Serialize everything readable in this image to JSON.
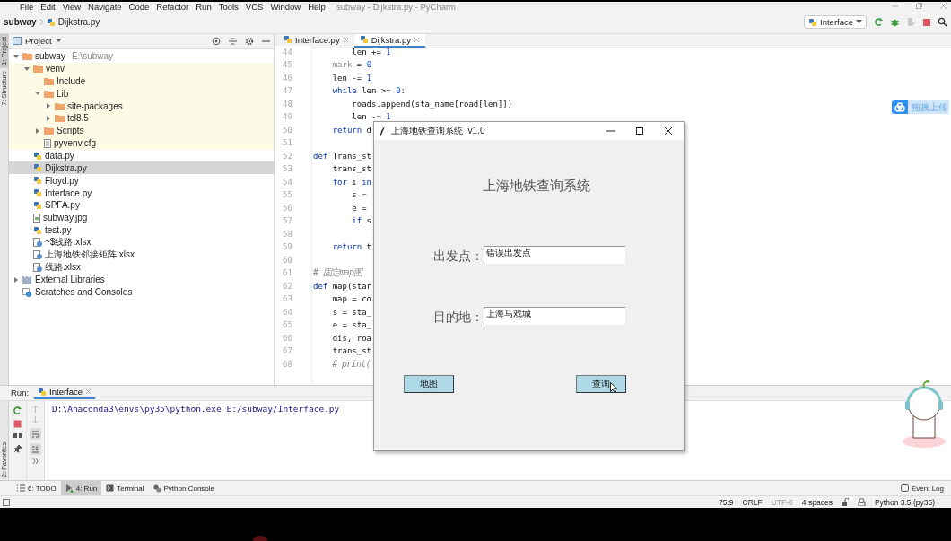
{
  "window": {
    "title": "subway - Dijkstra.py - PyCharm"
  },
  "menu": [
    "File",
    "Edit",
    "View",
    "Navigate",
    "Code",
    "Refactor",
    "Run",
    "Tools",
    "VCS",
    "Window",
    "Help"
  ],
  "breadcrumb": [
    {
      "label": "subway",
      "kind": "project"
    },
    {
      "label": "Dijkstra.py",
      "kind": "python"
    }
  ],
  "run_config": {
    "label": "Interface"
  },
  "side_tabs": [
    {
      "label": "1: Project",
      "selected": true
    },
    {
      "label": "7: Structure",
      "selected": false
    }
  ],
  "favorites_tab": {
    "label": "2: Favorites"
  },
  "project_panel": {
    "title": "Project",
    "tree": [
      {
        "label": "subway",
        "path": "E:\\subway",
        "kind": "folder",
        "expanded": true,
        "selected": false,
        "excluded": false,
        "children": [
          {
            "label": "venv",
            "kind": "folder",
            "expanded": true,
            "selected": false,
            "excluded": true,
            "children": [
              {
                "label": "Include",
                "kind": "folder",
                "selected": false,
                "excluded": true
              },
              {
                "label": "Lib",
                "kind": "folder",
                "expanded": true,
                "selected": false,
                "excluded": true,
                "children": [
                  {
                    "label": "site-packages",
                    "kind": "folder",
                    "expanded": false,
                    "selected": false,
                    "excluded": true
                  },
                  {
                    "label": "tcl8.5",
                    "kind": "folder",
                    "expanded": false,
                    "selected": false,
                    "excluded": true
                  }
                ]
              },
              {
                "label": "Scripts",
                "kind": "folder",
                "expanded": false,
                "selected": false,
                "excluded": true
              },
              {
                "label": "pyvenv.cfg",
                "kind": "text",
                "selected": false,
                "excluded": true
              }
            ]
          },
          {
            "label": "data.py",
            "kind": "python",
            "selected": false,
            "excluded": false
          },
          {
            "label": "Dijkstra.py",
            "kind": "python",
            "selected": true,
            "excluded": false
          },
          {
            "label": "Floyd.py",
            "kind": "python",
            "selected": false,
            "excluded": false
          },
          {
            "label": "Interface.py",
            "kind": "python",
            "selected": false,
            "excluded": false
          },
          {
            "label": "SPFA.py",
            "kind": "python",
            "selected": false,
            "excluded": false
          },
          {
            "label": "subway.jpg",
            "kind": "image",
            "selected": false,
            "excluded": false
          },
          {
            "label": "test.py",
            "kind": "python",
            "selected": false,
            "excluded": false
          },
          {
            "label": "~$线路.xlsx",
            "kind": "unknown",
            "selected": false,
            "excluded": false
          },
          {
            "label": "上海地铁邻接矩阵.xlsx",
            "kind": "unknown",
            "selected": false,
            "excluded": false
          },
          {
            "label": "线路.xlsx",
            "kind": "unknown",
            "selected": false,
            "excluded": false
          }
        ]
      },
      {
        "label": "External Libraries",
        "kind": "library",
        "expanded": false,
        "selected": false,
        "excluded": false
      },
      {
        "label": "Scratches and Consoles",
        "kind": "scratch",
        "selected": false,
        "excluded": false
      }
    ]
  },
  "editor": {
    "tabs": [
      {
        "label": "Interface.py",
        "selected": false
      },
      {
        "label": "Dijkstra.py",
        "selected": true
      }
    ],
    "lines": [
      {
        "number": "44",
        "segments": [
          {
            "text": "        len += ",
            "kind": "plain"
          },
          {
            "text": "1",
            "kind": "number"
          }
        ]
      },
      {
        "number": "45",
        "segments": [
          {
            "text": "    mark",
            "kind": "unused"
          },
          {
            "text": " = ",
            "kind": "plain"
          },
          {
            "text": "0",
            "kind": "number"
          }
        ]
      },
      {
        "number": "46",
        "segments": [
          {
            "text": "    len -= ",
            "kind": "plain"
          },
          {
            "text": "1",
            "kind": "number"
          }
        ]
      },
      {
        "number": "47",
        "segments": [
          {
            "text": "    while",
            "kind": "keyword"
          },
          {
            "text": " len >= ",
            "kind": "plain"
          },
          {
            "text": "0",
            "kind": "number"
          },
          {
            "text": ":",
            "kind": "plain"
          }
        ]
      },
      {
        "number": "48",
        "segments": [
          {
            "text": "        roads.append(sta_name[road[len]])",
            "kind": "plain"
          }
        ]
      },
      {
        "number": "49",
        "segments": [
          {
            "text": "        len -= ",
            "kind": "plain"
          },
          {
            "text": "1",
            "kind": "number"
          }
        ]
      },
      {
        "number": "50",
        "segments": [
          {
            "text": "    return",
            "kind": "keyword"
          },
          {
            "text": " d",
            "kind": "plain"
          }
        ]
      },
      {
        "number": "51"
      },
      {
        "number": "52",
        "segments": [
          {
            "text": "def",
            "kind": "keyword"
          },
          {
            "text": " Trans_st",
            "kind": "plain"
          }
        ]
      },
      {
        "number": "53",
        "segments": [
          {
            "text": "    trans_st",
            "kind": "plain"
          }
        ]
      },
      {
        "number": "54",
        "segments": [
          {
            "text": "    for",
            "kind": "keyword"
          },
          {
            "text": " i ",
            "kind": "plain"
          },
          {
            "text": "in",
            "kind": "keyword"
          }
        ]
      },
      {
        "number": "55",
        "segments": [
          {
            "text": "        s =",
            "kind": "plain"
          }
        ]
      },
      {
        "number": "56",
        "segments": [
          {
            "text": "        e =",
            "kind": "plain"
          }
        ]
      },
      {
        "number": "57",
        "segments": [
          {
            "text": "        if",
            "kind": "keyword"
          },
          {
            "text": " s",
            "kind": "plain"
          }
        ]
      },
      {
        "number": "58"
      },
      {
        "number": "59",
        "segments": [
          {
            "text": "    return",
            "kind": "keyword"
          },
          {
            "text": " t",
            "kind": "plain"
          }
        ]
      },
      {
        "number": "60"
      },
      {
        "number": "61",
        "segments": [
          {
            "text": "# 固定map图",
            "kind": "comment"
          }
        ]
      },
      {
        "number": "62",
        "segments": [
          {
            "text": "def",
            "kind": "keyword"
          },
          {
            "text": " map(star",
            "kind": "plain"
          }
        ]
      },
      {
        "number": "63",
        "segments": [
          {
            "text": "    map = co",
            "kind": "plain"
          }
        ]
      },
      {
        "number": "64",
        "segments": [
          {
            "text": "    s = sta_",
            "kind": "plain"
          }
        ]
      },
      {
        "number": "65",
        "segments": [
          {
            "text": "    e = sta_",
            "kind": "plain"
          }
        ]
      },
      {
        "number": "66",
        "segments": [
          {
            "text": "    dis, roa",
            "kind": "plain"
          }
        ]
      },
      {
        "number": "67",
        "segments": [
          {
            "text": "    trans_st",
            "kind": "plain"
          }
        ]
      },
      {
        "number": "68",
        "segments": [
          {
            "text": "    # print(",
            "kind": "comment"
          }
        ]
      }
    ]
  },
  "run_panel": {
    "label": "Run:",
    "tabs": [
      {
        "label": "Interface",
        "selected": true
      }
    ],
    "output": [
      "D:\\Anaconda3\\envs\\py35\\python.exe E:/subway/Interface.py"
    ]
  },
  "tool_tabs": [
    {
      "label": "6: TODO",
      "kind": "list",
      "selected": false
    },
    {
      "label": "4: Run",
      "kind": "run",
      "selected": true
    },
    {
      "label": "Terminal",
      "kind": "terminal",
      "selected": false
    },
    {
      "label": "Python Console",
      "kind": "console",
      "selected": false
    }
  ],
  "event_log": {
    "label": "Event Log"
  },
  "status_bar": {
    "items": [
      {
        "text": "75:9",
        "dimmed": false
      },
      {
        "text": "CRLF",
        "dimmed": false
      },
      {
        "text": "UTF-8",
        "dimmed": true
      },
      {
        "text": "4 spaces",
        "dimmed": false
      }
    ],
    "interpreter": "Python 3.5 (py35)"
  },
  "upload_widget": {
    "label": "拖拽上传"
  },
  "dialog": {
    "title": "上海地铁查询系统_v1.0",
    "heading": "上海地铁查询系统",
    "fields": [
      {
        "label": "出发点：",
        "value": "错误出发点"
      },
      {
        "label": "目的地：",
        "value": "上海马戏城"
      }
    ],
    "buttons": [
      {
        "label": "地图"
      },
      {
        "label": "查询"
      }
    ]
  }
}
